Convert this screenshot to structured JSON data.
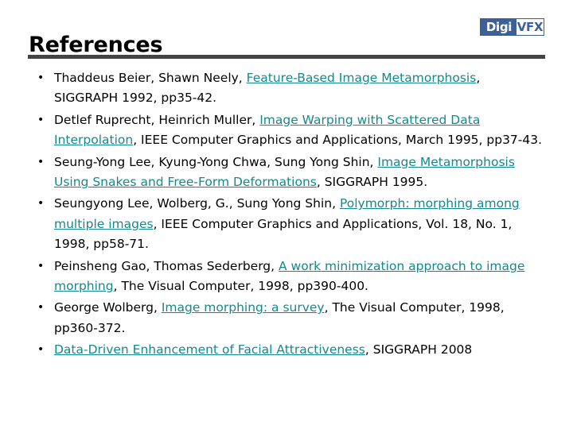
{
  "header": {
    "title": "References",
    "logo": {
      "name": "DigiVFX",
      "part1": "Digi",
      "part2": "VFX",
      "part1_bg": "#3f6096",
      "part1_color": "#ffffff",
      "part2_bg": "#ffffff",
      "part2_color": "#3f6096",
      "border_color": "#3c5f8e"
    },
    "divider_color": "#444444"
  },
  "theme": {
    "background": "#ffffff",
    "text_color": "#000000",
    "link_color": "#15888c"
  },
  "references": [
    {
      "id": "ref-beier-neely",
      "segments": [
        {
          "text": "Thaddeus Beier, Shawn Neely, ",
          "link": false
        },
        {
          "text": "Feature-Based Image Metamorphosis",
          "link": true
        },
        {
          "text": ", SIGGRAPH 1992, pp35-42.",
          "link": false
        }
      ]
    },
    {
      "id": "ref-ruprecht-muller",
      "segments": [
        {
          "text": "Detlef Ruprecht, Heinrich Muller, ",
          "link": false
        },
        {
          "text": "Image Warping with Scattered Data Interpolation",
          "link": true
        },
        {
          "text": ", IEEE Computer Graphics and Applications, March 1995, pp37-43.",
          "link": false
        }
      ]
    },
    {
      "id": "ref-lee-chwa-shin",
      "segments": [
        {
          "text": "Seung-Yong Lee, Kyung-Yong Chwa, Sung Yong Shin, ",
          "link": false
        },
        {
          "text": "Image Metamorphosis Using Snakes and Free-Form Deformations",
          "link": true
        },
        {
          "text": ", SIGGRAPH 1995.",
          "link": false
        }
      ]
    },
    {
      "id": "ref-polymorph",
      "segments": [
        {
          "text": "Seungyong Lee, Wolberg, G., Sung Yong Shin, ",
          "link": false
        },
        {
          "text": "Polymorph: morphing among multiple images",
          "link": true
        },
        {
          "text": ", IEEE Computer Graphics and Applications, Vol. 18, No. 1, 1998, pp58-71.",
          "link": false
        }
      ]
    },
    {
      "id": "ref-gao-sederberg",
      "segments": [
        {
          "text": "Peinsheng Gao, Thomas Sederberg, ",
          "link": false
        },
        {
          "text": "A work minimization approach to image morphing",
          "link": true
        },
        {
          "text": ", The Visual Computer, 1998, pp390-400.",
          "link": false
        }
      ]
    },
    {
      "id": "ref-wolberg-survey",
      "segments": [
        {
          "text": "George Wolberg, ",
          "link": false
        },
        {
          "text": "Image morphing: a survey",
          "link": true
        },
        {
          "text": ", The Visual Computer, 1998, pp360-372.",
          "link": false
        }
      ]
    },
    {
      "id": "ref-facial-attractiveness",
      "segments": [
        {
          "text": "",
          "link": false
        },
        {
          "text": "Data-Driven Enhancement of Facial Attractiveness",
          "link": true
        },
        {
          "text": ", SIGGRAPH 2008",
          "link": false
        }
      ]
    }
  ]
}
